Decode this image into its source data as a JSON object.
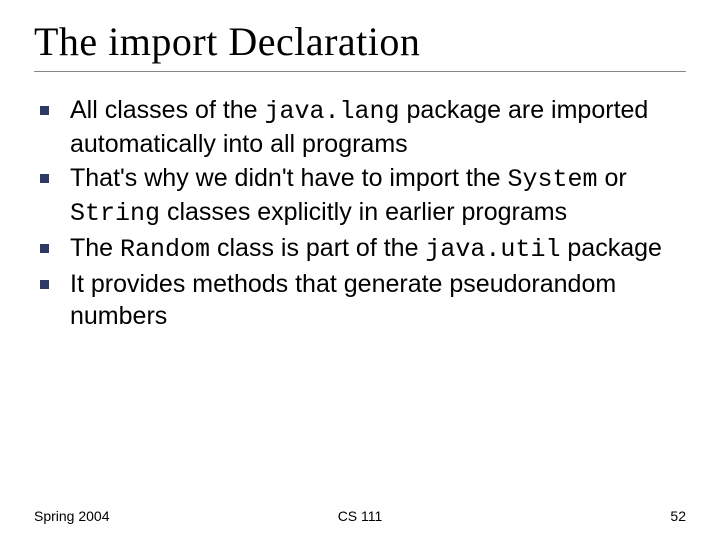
{
  "title": "The import Declaration",
  "bullets": [
    {
      "pre": "All classes of the ",
      "code1": "java.lang",
      "post": " package are imported automatically into all programs"
    },
    {
      "pre": "That's why we didn't have to import the ",
      "code1": "System",
      "mid": " or ",
      "code2": "String",
      "post": " classes explicitly in earlier programs"
    },
    {
      "pre": "The ",
      "code1": "Random",
      "mid": " class is part of the ",
      "code2": "java.util",
      "post": " package"
    },
    {
      "pre": "It provides methods that generate pseudorandom numbers",
      "code1": "",
      "post": ""
    }
  ],
  "footer": {
    "left": "Spring 2004",
    "center": "CS 111",
    "right": "52"
  }
}
